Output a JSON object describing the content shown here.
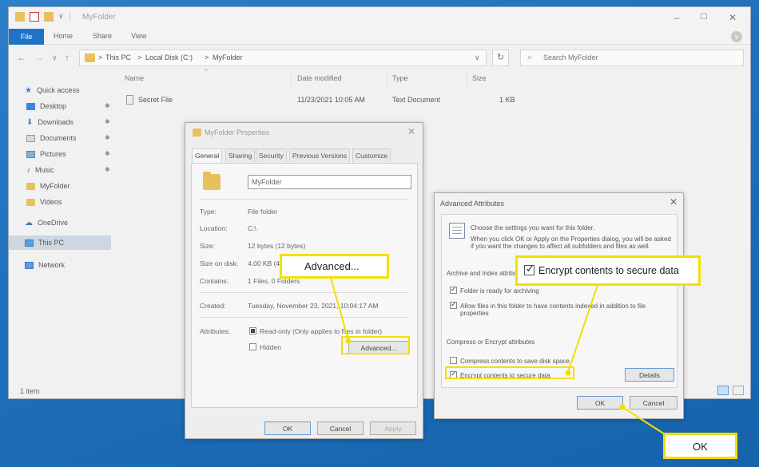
{
  "colors": {
    "desktop": "#1f6fbb",
    "highlight": "#f2e000",
    "file_tab": "#1e73c9",
    "folder": "#e8c15a"
  },
  "explorer": {
    "title": "MyFolder",
    "qa_dropdown": "∨",
    "window_controls": {
      "minimize": "–",
      "maximize": "☐",
      "close": "✕"
    },
    "ribbon": {
      "file": "File",
      "home": "Home",
      "share": "Share",
      "view": "View",
      "expand": "∨"
    },
    "nav_buttons": {
      "back": "←",
      "forward": "→",
      "recent": "∨",
      "up": "↑"
    },
    "breadcrumbs": [
      "This PC",
      "Local Disk (C:)",
      "MyFolder"
    ],
    "crumb_sep": ">",
    "address_dropdown": "∨",
    "refresh": "↻",
    "search": {
      "icon": "search-icon",
      "placeholder": "Search MyFolder"
    },
    "nav_pane": {
      "quick_access": "Quick access",
      "items": [
        {
          "label": "Desktop",
          "icon": "desktop-icon",
          "pinned": true
        },
        {
          "label": "Downloads",
          "icon": "download-icon",
          "pinned": true
        },
        {
          "label": "Documents",
          "icon": "documents-icon",
          "pinned": true
        },
        {
          "label": "Pictures",
          "icon": "pictures-icon",
          "pinned": true
        },
        {
          "label": "Music",
          "icon": "music-icon",
          "pinned": true
        },
        {
          "label": "MyFolder",
          "icon": "folder-icon",
          "pinned": false
        },
        {
          "label": "Videos",
          "icon": "videos-icon",
          "pinned": false
        }
      ],
      "pin_glyph": "✱",
      "onedrive": "OneDrive",
      "this_pc": "This PC",
      "network": "Network"
    },
    "columns": {
      "name": "Name",
      "date": "Date modified",
      "type": "Type",
      "size": "Size"
    },
    "sort_glyph": "^",
    "files": [
      {
        "name": "Secret File",
        "date": "11/23/2021 10:05 AM",
        "type": "Text Document",
        "size": "1 KB"
      }
    ],
    "status": "1 item"
  },
  "properties": {
    "title": "MyFolder Properties",
    "close": "✕",
    "tabs": [
      "General",
      "Sharing",
      "Security",
      "Previous Versions",
      "Customize"
    ],
    "name_value": "MyFolder",
    "type_label": "Type:",
    "type_value": "File folder",
    "location_label": "Location:",
    "location_value": "C:\\",
    "size_label": "Size:",
    "size_value": "12 bytes (12 bytes)",
    "size_on_disk_label": "Size on disk:",
    "size_on_disk_value": "4.00 KB (4",
    "contains_label": "Contains:",
    "contains_value": "1 Files, 0 Folders",
    "created_label": "Created:",
    "created_value": "Tuesday, November 23, 2021, 10:04:17 AM",
    "attributes_label": "Attributes:",
    "readonly_label": "Read-only (Only applies to files in folder)",
    "hidden_label": "Hidden",
    "advanced_button": "Advanced...",
    "ok": "OK",
    "cancel": "Cancel",
    "apply": "Apply"
  },
  "advanced": {
    "title": "Advanced Attributes",
    "close": "✕",
    "intro_1": "Choose the settings you want for this folder.",
    "intro_2": "When you click OK or Apply on the Properties dialog, you will be asked if you want the changes to affect all subfolders and files as well.",
    "archive_group": "Archive and Index attributes",
    "archive_label": "Folder is ready for archiving",
    "index_label": "Allow files in this folder to have contents indexed in addition to file properties",
    "compress_group": "Compress or Encrypt attributes",
    "compress_label": "Compress contents to save disk space",
    "encrypt_label": "Encrypt contents to secure data",
    "details_button": "Details",
    "ok": "OK",
    "cancel": "Cancel"
  },
  "callouts": {
    "advanced": "Advanced...",
    "encrypt": "Encrypt contents to secure data",
    "ok": "OK"
  }
}
